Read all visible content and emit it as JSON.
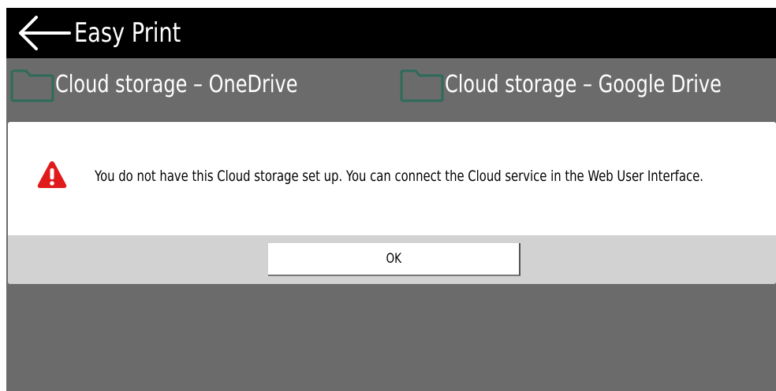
{
  "header": {
    "title": "Easy Print",
    "back_icon": "arrow-left-icon"
  },
  "tiles": [
    {
      "label": "Cloud storage – OneDrive",
      "icon": "folder-icon"
    },
    {
      "label": "Cloud storage – Google Drive",
      "icon": "folder-icon"
    }
  ],
  "dialog": {
    "icon": "warning-icon",
    "message": "You do not have this Cloud storage set up. You can connect the Cloud service in the Web User Interface.",
    "ok_label": "OK"
  },
  "colors": {
    "header_bg": "#000000",
    "screen_bg": "#6b6b6b",
    "folder_stroke": "#2e6b5a",
    "warning_red": "#e01b1b",
    "dialog_footer_bg": "#d2d2d2"
  }
}
